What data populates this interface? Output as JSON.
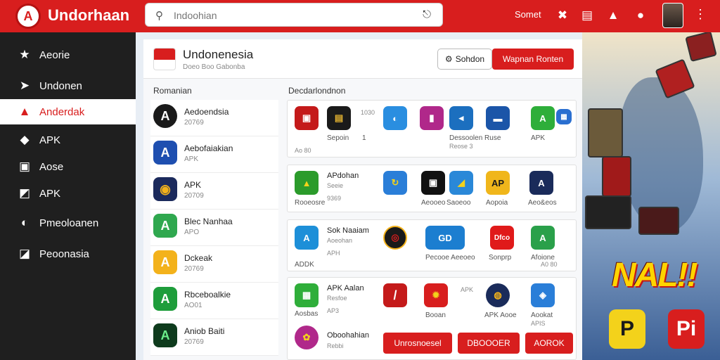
{
  "topbar": {
    "brand": "Undorhaan",
    "logo_letter": "A",
    "search_placeholder": "Indoohian",
    "link": "Somet",
    "icons": [
      "search-icon",
      "mic-icon",
      "tools-icon",
      "list-icon",
      "user-icon",
      "message-icon",
      "more-icon"
    ]
  },
  "sidebar": {
    "items": [
      {
        "label": "Aeorie",
        "icon": "★",
        "icon_name": "star-icon",
        "active": false
      },
      {
        "label": "Undonen",
        "icon": "➤",
        "icon_name": "send-icon",
        "active": false
      },
      {
        "label": "Anderdak",
        "icon": "▲",
        "icon_name": "android-icon",
        "active": true
      },
      {
        "label": "APK",
        "icon": "◆",
        "icon_name": "apk-icon",
        "active": false
      },
      {
        "label": "Aose",
        "icon": "▣",
        "icon_name": "grid-icon",
        "active": false
      },
      {
        "label": "APK",
        "icon": "◩",
        "icon_name": "package-icon",
        "active": false
      },
      {
        "label": "Pmeoloanen",
        "icon": "◐",
        "icon_name": "circle-icon",
        "active": false
      },
      {
        "label": "Peoonasia",
        "icon": "◪",
        "icon_name": "folder-icon",
        "active": false
      }
    ]
  },
  "header": {
    "title": "Undonenesia",
    "subtitle": "Doeo Boo Gabonba",
    "secondary_button": "Sohdon",
    "primary_button": "Wapnan Ronten"
  },
  "left_column": {
    "title": "Romanian",
    "items": [
      {
        "name": "Aedoendsia",
        "size": "20769",
        "color": "#1a1a1a",
        "glyph": "A"
      },
      {
        "name": "Aebofaiakian",
        "size": "APK",
        "color": "#1e4fb0",
        "glyph": "A"
      },
      {
        "name": "APK",
        "size": "20709",
        "color": "#1b2a5c",
        "glyph": "◉"
      },
      {
        "name": "Blec Nanhaa",
        "size": "APO",
        "color": "#2fa84f",
        "glyph": "A"
      },
      {
        "name": "Dckeak",
        "size": "20769",
        "color": "#f3b21b",
        "glyph": "A"
      },
      {
        "name": "Rbceboalkie",
        "size": "AO01",
        "color": "#1e9d3b",
        "glyph": "A"
      },
      {
        "name": "Aniob Baiti",
        "size": "20769",
        "color": "#0e3b1d",
        "glyph": "A"
      }
    ]
  },
  "right_column": {
    "title": "Decdarlondnon",
    "rows": [
      {
        "tiles": [
          {
            "label": "",
            "color": "#c41a1a",
            "glyph": "▣"
          },
          {
            "label": "Sepoin",
            "color": "#1a1a1a",
            "glyph": "▤"
          },
          {
            "label": "1",
            "color": "#ffffff",
            "glyph": ""
          },
          {
            "label": "",
            "color": "#2a8ee0",
            "glyph": "◐"
          },
          {
            "label": "",
            "color": "#b0288a",
            "glyph": "▮"
          },
          {
            "label": "Dessoolen Ruse",
            "color": "#1c6fbf",
            "glyph": "◂"
          },
          {
            "label": "",
            "color": "#1b55a8",
            "glyph": "▬"
          },
          {
            "label": "APK",
            "color": "#2eae3a",
            "glyph": "A"
          },
          {
            "label": "",
            "color": "#2a6fd0",
            "glyph": "▦"
          }
        ],
        "meta": [
          "1030",
          "Ao 80",
          "Reose 3"
        ]
      },
      {
        "title": "APdohan",
        "sub": "Seeie",
        "tiles": [
          {
            "label": "Rooeosre",
            "color": "#2b9b2b",
            "glyph": "▲"
          },
          {
            "label": "",
            "color": "#2a7ed8",
            "glyph": "↻"
          },
          {
            "label": "Aeooeo",
            "color": "#111111",
            "glyph": "▣"
          },
          {
            "label": "Saoeoo",
            "color": "#2a88d8",
            "glyph": "◢"
          },
          {
            "label": "Aopoia",
            "color": "#f0b61b",
            "glyph": "AP"
          },
          {
            "label": "Aeo&eos",
            "color": "#1a2b5a",
            "glyph": "A"
          }
        ],
        "meta": [
          "9369"
        ]
      },
      {
        "title": "Sok Naaiam",
        "sub": "Aoeohan",
        "tiles": [
          {
            "label": "ADDK",
            "color": "#1d8fd8",
            "glyph": "A"
          },
          {
            "label": "",
            "color": "#1a1a1a",
            "glyph": "◎"
          },
          {
            "label": "Pecooe Aeeoeo",
            "color": "#1c7ed0",
            "glyph": "GD"
          },
          {
            "label": "Sonprp",
            "color": "#e01a1a",
            "glyph": "Dfco"
          },
          {
            "label": "Afoione",
            "color": "#2aa04a",
            "glyph": "A"
          }
        ],
        "meta": [
          "APH",
          "A0 80"
        ]
      },
      {
        "title": "APK Aalan",
        "sub": "Resfoe",
        "tiles": [
          {
            "label": "Aosbas",
            "color": "#2fae3a",
            "glyph": "▦"
          },
          {
            "label": "",
            "color": "#c41a1a",
            "glyph": "/"
          },
          {
            "label": "Booan",
            "color": "#d81e1e",
            "glyph": "✹"
          },
          {
            "label": "APK Aooe",
            "color": "#1a2b5a",
            "glyph": "◍"
          },
          {
            "label": "Aookat",
            "color": "#2a7ed8",
            "glyph": "◈"
          }
        ],
        "meta": [
          "AP3",
          "APK",
          "APIS"
        ]
      },
      {
        "title": "Oboohahian",
        "sub": "Rebbi",
        "icon_color": "#b0288a"
      }
    ],
    "buttons": [
      "Unrosnoesel",
      "DBOOOER",
      "AOROK"
    ]
  },
  "promo": {
    "headline": "NAL!!",
    "icon_left_glyph": "P",
    "icon_right_glyph": "Pi"
  }
}
